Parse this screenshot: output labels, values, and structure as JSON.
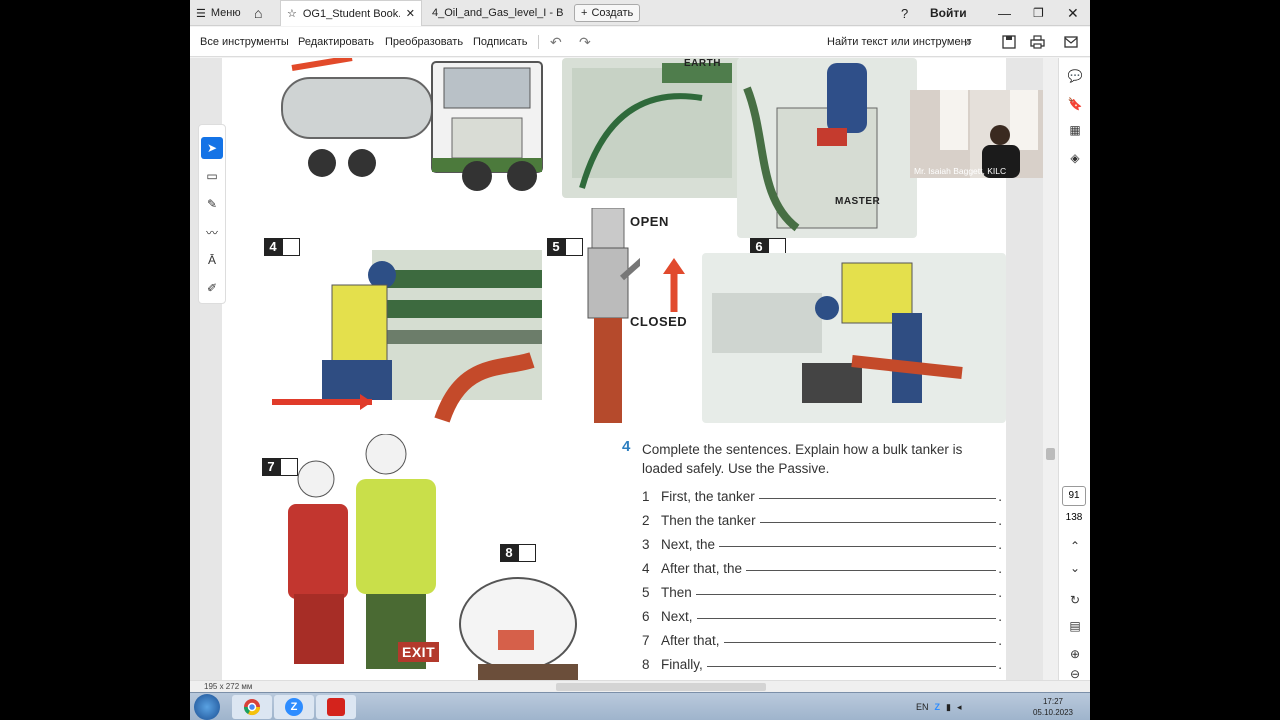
{
  "tabbar": {
    "menu_label": "Меню",
    "tab1_title": "OG1_Student Book....",
    "tab2_title": "4_Oil_and_Gas_level_I - B...",
    "new_label": "Создать",
    "signin_label": "Войти"
  },
  "toolbar": {
    "all_tools": "Все инструменты",
    "edit": "Редактировать",
    "convert": "Преобразовать",
    "sign": "Подписать",
    "find": "Найти текст или инструмент"
  },
  "page": {
    "labels": {
      "earth": "EARTH",
      "open": "OPEN",
      "closed": "CLOSED",
      "master": "MASTER",
      "exit": "EXIT"
    },
    "boxes": [
      "4",
      "5",
      "6",
      "7",
      "8"
    ],
    "exercise": {
      "number": "4",
      "instruction": "Complete the sentences. Explain how a bulk tanker is loaded safely. Use the Passive.",
      "rows": [
        {
          "n": "1",
          "text": "First, the tanker"
        },
        {
          "n": "2",
          "text": "Then the tanker"
        },
        {
          "n": "3",
          "text": "Next, the"
        },
        {
          "n": "4",
          "text": "After that, the"
        },
        {
          "n": "5",
          "text": "Then"
        },
        {
          "n": "6",
          "text": "Next,"
        },
        {
          "n": "7",
          "text": "After that,"
        },
        {
          "n": "8",
          "text": "Finally,"
        }
      ]
    }
  },
  "video": {
    "caption": "Mr. Isaiah Baggett, KILC"
  },
  "navigation": {
    "current_page": "91",
    "total_pages": "138"
  },
  "status": {
    "doc_size": "195 x 272 мм"
  },
  "tray": {
    "lang": "EN",
    "time": "17:27",
    "date": "05.10.2023"
  }
}
